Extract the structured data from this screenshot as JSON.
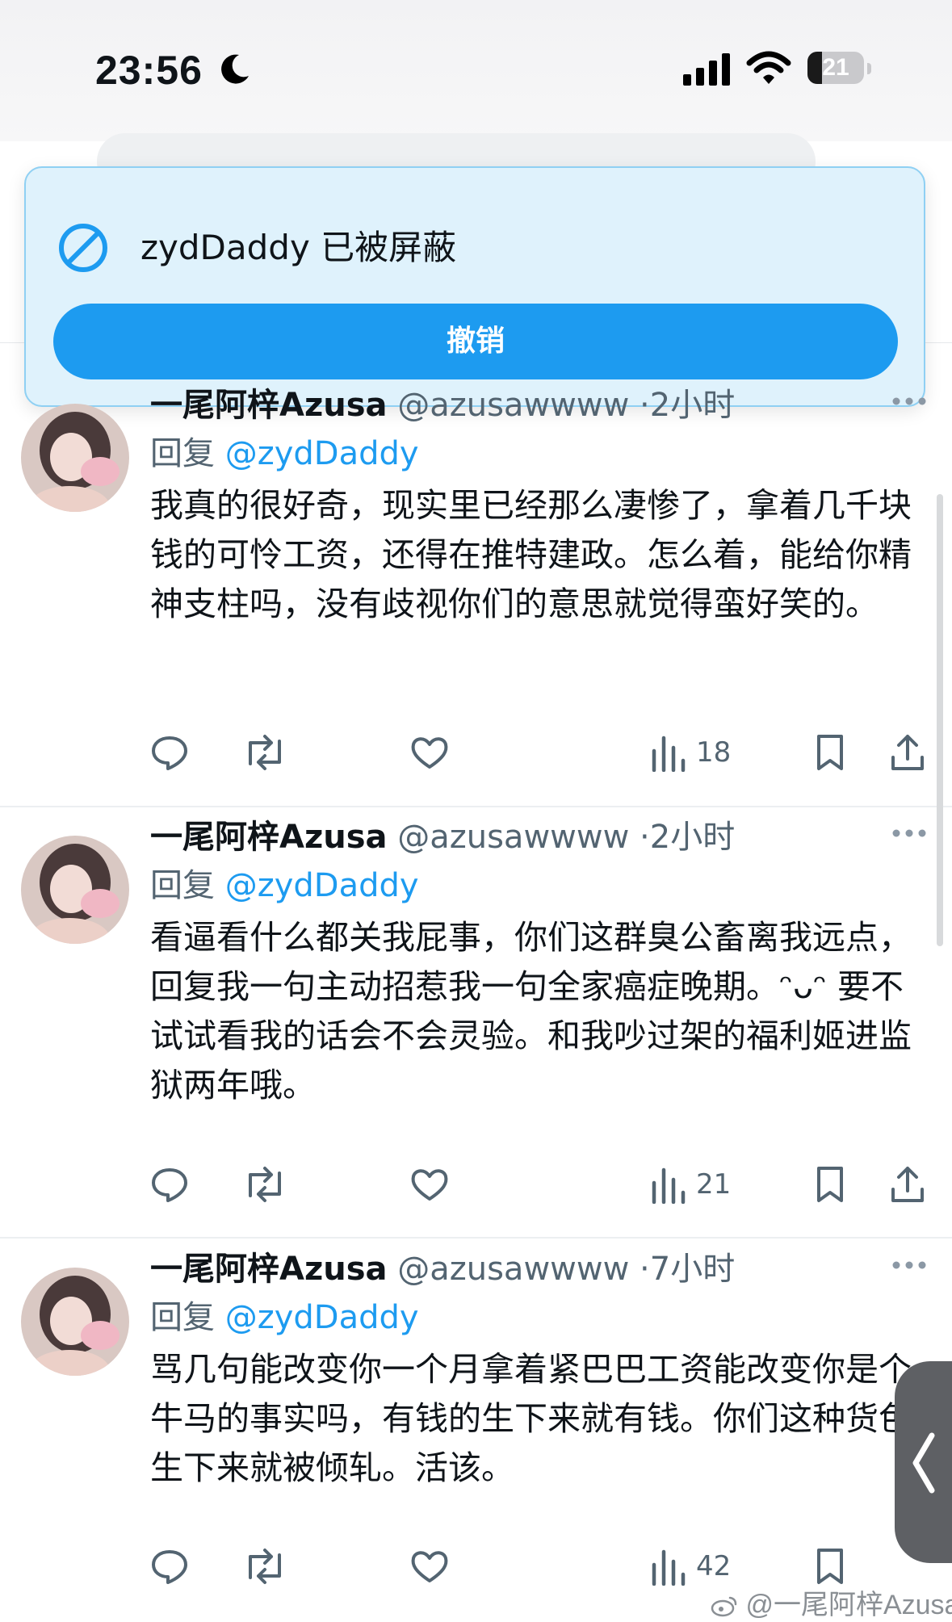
{
  "status_bar": {
    "time": "23:56",
    "battery": "21"
  },
  "toast": {
    "message": "zydDaddy 已被屏蔽",
    "undo_label": "撤销"
  },
  "tweets": [
    {
      "name": "一尾阿梓Azusa",
      "handle": "@azusawwww",
      "time": "·2小时",
      "reply_prefix": "回复",
      "reply_to": "@zydDaddy",
      "text": "我真的很好奇，现实里已经那么凄惨了，拿着几千块钱的可怜工资，还得在推特建政。怎么着，能给你精神支柱吗，没有歧视你们的意思就觉得蛮好笑的。",
      "views": "18"
    },
    {
      "name": "一尾阿梓Azusa",
      "handle": "@azusawwww",
      "time": "·2小时",
      "reply_prefix": "回复",
      "reply_to": "@zydDaddy",
      "text": "看逼看什么都关我屁事，你们这群臭公畜离我远点，回复我一句主动招惹我一句全家癌症晚期。ᵔᴗᵔ 要不试试看我的话会不会灵验。和我吵过架的福利姬进监狱两年哦。",
      "views": "21"
    },
    {
      "name": "一尾阿梓Azusa",
      "handle": "@azusawwww",
      "time": "·7小时",
      "reply_prefix": "回复",
      "reply_to": "@zydDaddy",
      "text": "骂几句能改变你一个月拿着紧巴巴工资能改变你是个牛马的事实吗，有钱的生下来就有钱。你们这种货色生下来就被倾轧。活该。",
      "views": "42"
    }
  ],
  "icons": [
    "moon-icon",
    "signal-icon",
    "wifi-icon",
    "battery-icon",
    "blocked-icon",
    "more-icon",
    "reply-icon",
    "retweet-icon",
    "like-icon",
    "views-icon",
    "bookmark-icon",
    "share-icon",
    "back-chevron-icon",
    "weibo-icon"
  ],
  "watermark": "@一尾阿梓Azusa",
  "colors": {
    "accent": "#1d9bf0",
    "toast_bg": "#dff2fc",
    "text": "#0f1419",
    "muted": "#536471"
  }
}
